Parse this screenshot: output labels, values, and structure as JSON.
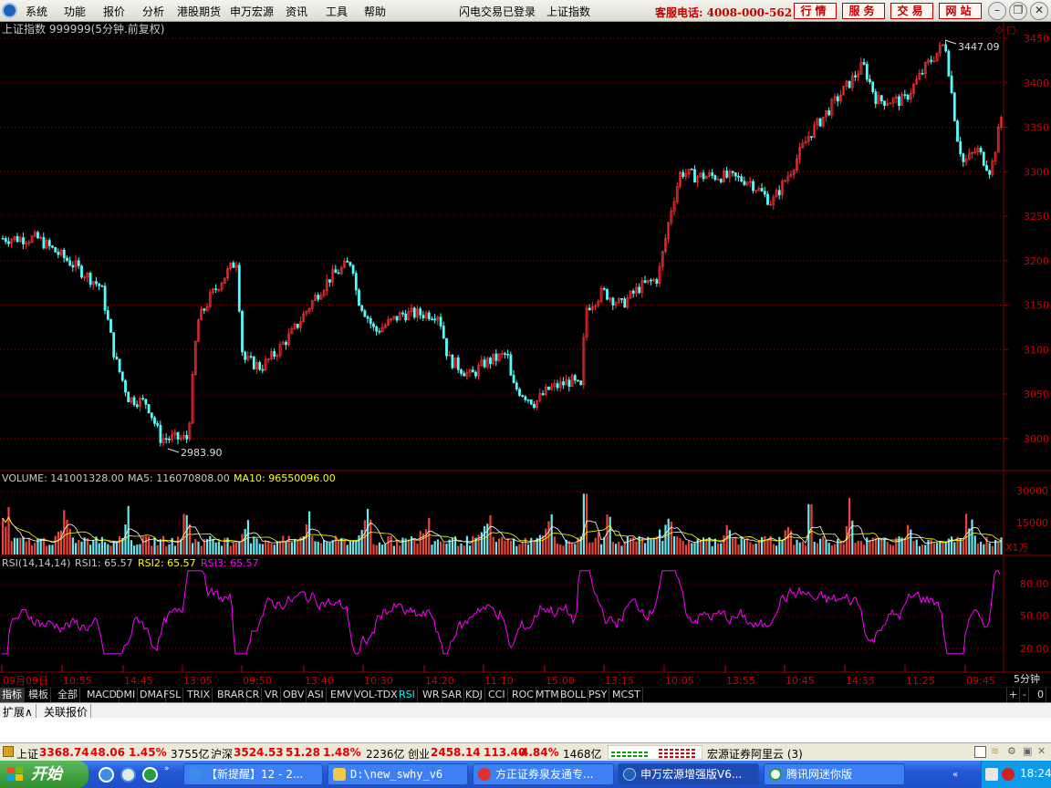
{
  "menu": {
    "items": [
      "系统",
      "功能",
      "报价",
      "分析",
      "港股期货",
      "申万宏源",
      "资讯",
      "工具",
      "帮助"
    ],
    "login_status": "闪电交易已登录",
    "market": "上证指数"
  },
  "hotline": "客服电话: 4008-000-562",
  "top_buttons": [
    "行情",
    "服务",
    "交易",
    "网站"
  ],
  "chart": {
    "title": "上证指数 999999(5分钟.前复权)",
    "y_ticks": [
      "3450",
      "3400",
      "3350",
      "3300",
      "3250",
      "3200",
      "3150",
      "3100",
      "3050",
      "3000"
    ],
    "high_label": "3447.09",
    "low_label": "2983.90"
  },
  "volume": {
    "label": "VOLUME: 141001328.00",
    "ma5": "MA5: 116070808.00",
    "ma10": "MA10: 96550096.00",
    "y_ticks": [
      "30000",
      "15000"
    ],
    "unit": "X1万"
  },
  "rsi": {
    "label": "RSI(14,14,14)",
    "rsi1": "RSI1: 65.57",
    "rsi2": "RSI2: 65.57",
    "rsi3": "RSI3: 65.57",
    "y_ticks": [
      "80.00",
      "50.00",
      "20.00"
    ]
  },
  "time_axis": {
    "labels": [
      "09月09日",
      "10:55",
      "14:45",
      "13:05",
      "09:50",
      "13:40",
      "10:30",
      "14:20",
      "11:10",
      "15:00",
      "13:15",
      "10:05",
      "13:55",
      "10:45",
      "14:35",
      "11:25",
      "09:45"
    ],
    "period": "5分钟"
  },
  "indicator_tabs": [
    "指标",
    "模板",
    "全部",
    "MACD",
    "DMI",
    "DMA",
    "FSL",
    "TRIX",
    "BRAR",
    "CR",
    "VR",
    "OBV",
    "ASI",
    "EMV",
    "VOL-TDX",
    "RSI",
    "WR",
    "SAR",
    "KDJ",
    "CCI",
    "ROC",
    "MTM",
    "BOLL",
    "PSY",
    "MCST"
  ],
  "tab_controls": [
    "+",
    "-",
    "0"
  ],
  "expand": [
    "扩展∧",
    "关联报价"
  ],
  "ticker": {
    "sh_name": "上证",
    "sh_val": "3368.74",
    "sh_chg": "48.06",
    "sh_pct": "1.45%",
    "sh_amt": "3755亿",
    "hs_name": "沪深",
    "hs_val": "3524.53",
    "hs_chg": "51.28",
    "hs_pct": "1.48%",
    "hs_amt": "2236亿",
    "cy_name": "创业",
    "cy_val": "2458.14",
    "cy_chg": "113.40",
    "cy_pct": "4.84%",
    "cy_amt": "1468亿",
    "server": "宏源证券阿里云 (3)"
  },
  "taskbar": {
    "start": "开始",
    "tasks": [
      "【新提醒】12 - 2...",
      "D:\\new_swhy_v6",
      "方正证券泉友通专...",
      "申万宏源增强版V6...",
      "腾讯网迷你版"
    ],
    "clock": "18:24"
  },
  "colors": {
    "up": "#ff3232",
    "down": "#54fcfc",
    "grid": "#8b0000",
    "rsi": "#ff00ff",
    "ma10": "#ffff00"
  }
}
